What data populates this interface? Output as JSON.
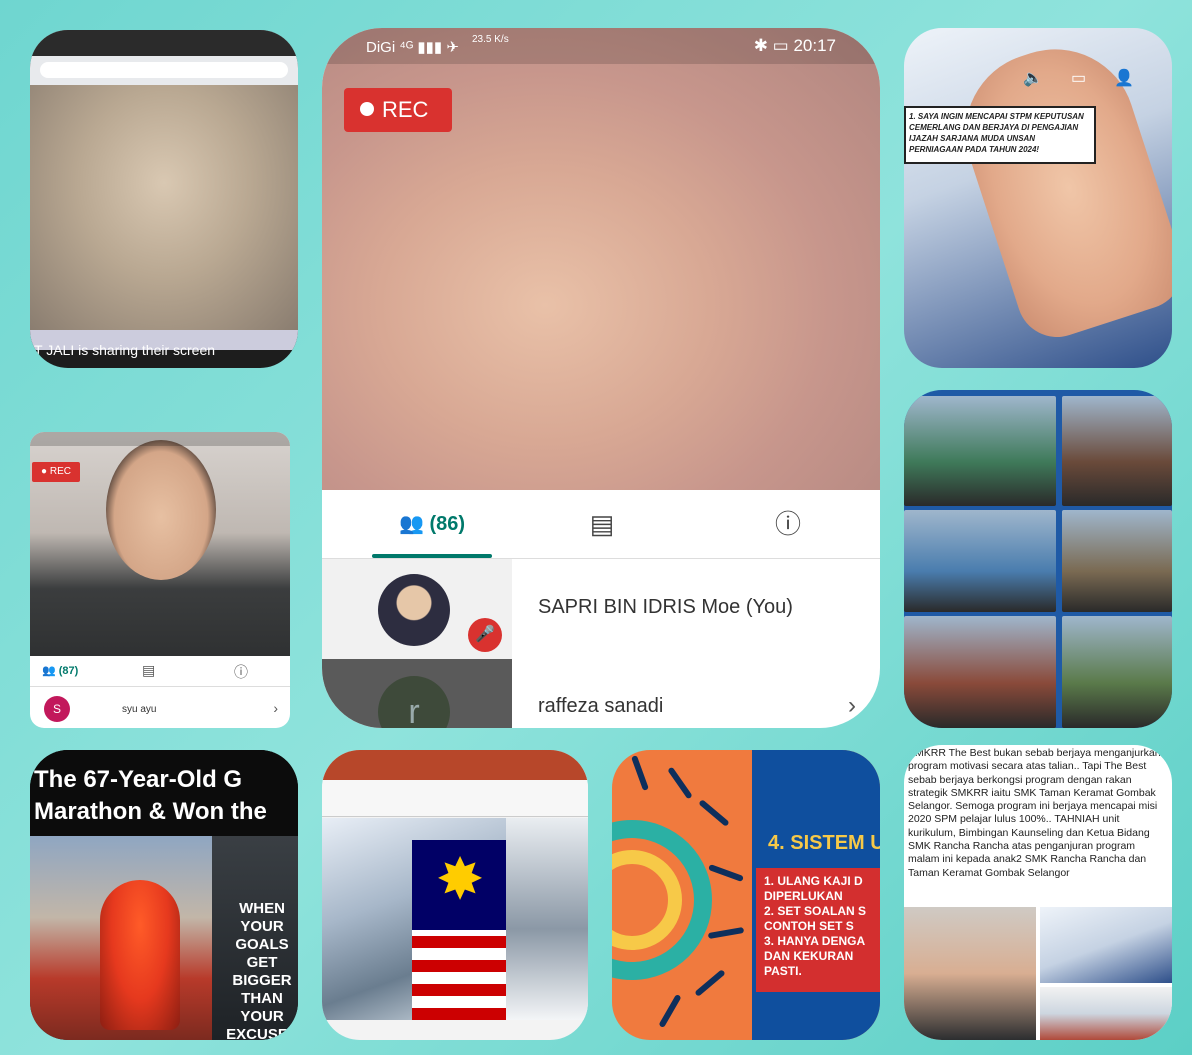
{
  "tile1": {
    "share_text": "T JALI is sharing their screen"
  },
  "tile2": {
    "status_left": "DiGi ⁴ᴳ ▮▮▮ ✈",
    "status_speed": "23.5 K/s",
    "time": "20:17",
    "status_icons": "✱ ▭",
    "rec_label": "REC",
    "people_count": "(86)",
    "participants": [
      {
        "name": "SAPRI BIN IDRIS Moe (You)"
      },
      {
        "name": "raffeza sanadi",
        "initial": "r"
      }
    ]
  },
  "tile3": {
    "banner_text": "1. SAYA INGIN MENCAPAI STPM KEPUTUSAN CEMERLANG DAN BERJAYA DI PENGAJIAN IJAZAH SARJANA MUDA UNSAN PERNIAGAAN PADA TAHUN 2024!",
    "icons": [
      "speaker-icon",
      "cc-icon",
      "people-icon"
    ]
  },
  "tile4": {
    "rec_label": "REC",
    "people_count": "(87)",
    "participant_initial": "S",
    "participant_name": "syu ayu"
  },
  "tile5": {
    "cells": [
      {
        "bg": "#3f7a5a"
      },
      {
        "bg": "#6a4a3a"
      },
      {
        "bg": "#4a7dae"
      },
      {
        "bg": "#7a6a52"
      },
      {
        "bg": "#8a4a3a"
      },
      {
        "bg": "#5a7a4a"
      }
    ]
  },
  "tile6": {
    "headline_1": "The 67-Year-Old G",
    "headline_2": "Marathon & Won the",
    "poster_text": "WHEN YOUR GOALS GET BIGGER THAN YOUR EXCUSES"
  },
  "tile8": {
    "heading": "4. SISTEM U",
    "items": [
      "1.  ULANG KAJI D",
      "     DIPERLUKAN",
      "2.  SET SOALAN S",
      "     CONTOH SET S",
      "3.  HANYA DENGA",
      "     DAN KEKURAN",
      "     PASTI."
    ]
  },
  "tile9": {
    "paragraph": "SMKRR The Best bukan sebab berjaya menganjurkan program motivasi secara atas talian.. Tapi The Best sebab berjaya berkongsi program dengan rakan strategik SMKRR iaitu SMK Taman Keramat Gombak Selangor. Semoga program ini berjaya mencapai misi 2020 SPM pelajar lulus 100%.. TAHNIAH unit kurikulum, Bimbingan Kaunseling dan Ketua Bidang SMK Rancha Rancha atas penganjuran program malam ini kepada anak2 SMK Rancha Rancha dan Taman Keramat Gombak Selangor"
  },
  "colors": {
    "rec_red": "#d9322f",
    "meet_green": "#00796b",
    "background_teal": "#6fd6d0"
  }
}
